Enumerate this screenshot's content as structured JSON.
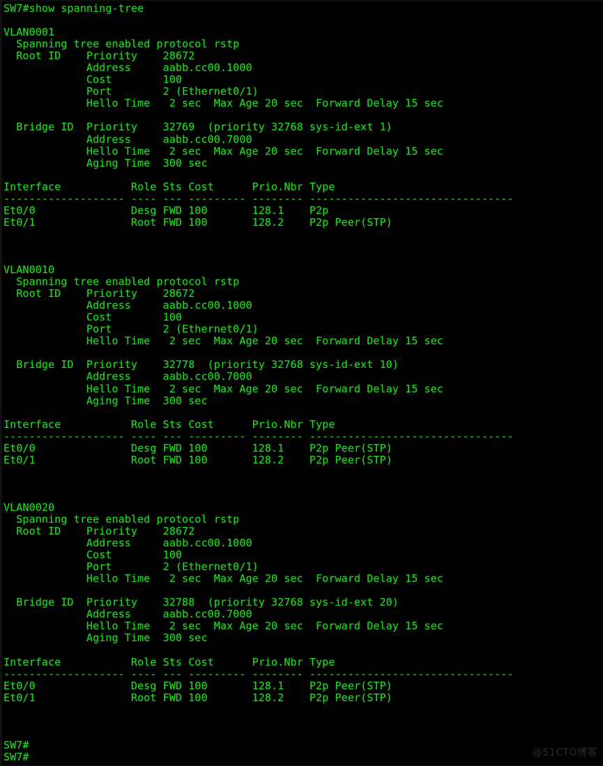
{
  "terminal": {
    "colors": {
      "background": "#000000",
      "foreground": "#1fd81f",
      "watermark": "#2c2c2c"
    },
    "prompt": "SW7#",
    "command": "show spanning-tree",
    "command_line": "SW7#show spanning-tree",
    "watermark": "@51CTO博客",
    "lines": [
      "SW7#show spanning-tree",
      "",
      "VLAN0001",
      "  Spanning tree enabled protocol rstp",
      "  Root ID    Priority    28672",
      "             Address     aabb.cc00.1000",
      "             Cost        100",
      "             Port        2 (Ethernet0/1)",
      "             Hello Time   2 sec  Max Age 20 sec  Forward Delay 15 sec",
      "",
      "  Bridge ID  Priority    32769  (priority 32768 sys-id-ext 1)",
      "             Address     aabb.cc00.7000",
      "             Hello Time   2 sec  Max Age 20 sec  Forward Delay 15 sec",
      "             Aging Time  300 sec",
      "",
      "Interface           Role Sts Cost      Prio.Nbr Type",
      "------------------- ---- --- --------- -------- --------------------------------",
      "Et0/0               Desg FWD 100       128.1    P2p",
      "Et0/1               Root FWD 100       128.2    P2p Peer(STP)",
      "",
      "",
      "",
      "VLAN0010",
      "  Spanning tree enabled protocol rstp",
      "  Root ID    Priority    28672",
      "             Address     aabb.cc00.1000",
      "             Cost        100",
      "             Port        2 (Ethernet0/1)",
      "             Hello Time   2 sec  Max Age 20 sec  Forward Delay 15 sec",
      "",
      "  Bridge ID  Priority    32778  (priority 32768 sys-id-ext 10)",
      "             Address     aabb.cc00.7000",
      "             Hello Time   2 sec  Max Age 20 sec  Forward Delay 15 sec",
      "             Aging Time  300 sec",
      "",
      "Interface           Role Sts Cost      Prio.Nbr Type",
      "------------------- ---- --- --------- -------- --------------------------------",
      "Et0/0               Desg FWD 100       128.1    P2p Peer(STP)",
      "Et0/1               Root FWD 100       128.2    P2p Peer(STP)",
      "",
      "",
      "",
      "VLAN0020",
      "  Spanning tree enabled protocol rstp",
      "  Root ID    Priority    28672",
      "             Address     aabb.cc00.1000",
      "             Cost        100",
      "             Port        2 (Ethernet0/1)",
      "             Hello Time   2 sec  Max Age 20 sec  Forward Delay 15 sec",
      "",
      "  Bridge ID  Priority    32788  (priority 32768 sys-id-ext 20)",
      "             Address     aabb.cc00.7000",
      "             Hello Time   2 sec  Max Age 20 sec  Forward Delay 15 sec",
      "             Aging Time  300 sec",
      "",
      "Interface           Role Sts Cost      Prio.Nbr Type",
      "------------------- ---- --- --------- -------- --------------------------------",
      "Et0/0               Desg FWD 100       128.1    P2p Peer(STP)",
      "Et0/1               Root FWD 100       128.2    P2p Peer(STP)",
      "",
      "",
      "",
      "SW7#",
      "SW7#"
    ]
  },
  "spanning_tree": {
    "table_headers": [
      "Interface",
      "Role",
      "Sts",
      "Cost",
      "Prio.Nbr",
      "Type"
    ],
    "vlans": [
      {
        "name": "VLAN0001",
        "protocol_line": "Spanning tree enabled protocol rstp",
        "protocol": "rstp",
        "root_id": {
          "priority": "28672",
          "address": "aabb.cc00.1000",
          "cost": "100",
          "port": "2 (Ethernet0/1)",
          "hello_time": "2 sec",
          "max_age": "20 sec",
          "forward_delay": "15 sec"
        },
        "bridge_id": {
          "priority": "32769",
          "priority_detail": "(priority 32768 sys-id-ext 1)",
          "base_priority": "32768",
          "sys_id_ext": "1",
          "address": "aabb.cc00.7000",
          "hello_time": "2 sec",
          "max_age": "20 sec",
          "forward_delay": "15 sec",
          "aging_time": "300 sec"
        },
        "interfaces": [
          {
            "interface": "Et0/0",
            "role": "Desg",
            "sts": "FWD",
            "cost": "100",
            "prio_nbr": "128.1",
            "type": "P2p"
          },
          {
            "interface": "Et0/1",
            "role": "Root",
            "sts": "FWD",
            "cost": "100",
            "prio_nbr": "128.2",
            "type": "P2p Peer(STP)"
          }
        ]
      },
      {
        "name": "VLAN0010",
        "protocol_line": "Spanning tree enabled protocol rstp",
        "protocol": "rstp",
        "root_id": {
          "priority": "28672",
          "address": "aabb.cc00.1000",
          "cost": "100",
          "port": "2 (Ethernet0/1)",
          "hello_time": "2 sec",
          "max_age": "20 sec",
          "forward_delay": "15 sec"
        },
        "bridge_id": {
          "priority": "32778",
          "priority_detail": "(priority 32768 sys-id-ext 10)",
          "base_priority": "32768",
          "sys_id_ext": "10",
          "address": "aabb.cc00.7000",
          "hello_time": "2 sec",
          "max_age": "20 sec",
          "forward_delay": "15 sec",
          "aging_time": "300 sec"
        },
        "interfaces": [
          {
            "interface": "Et0/0",
            "role": "Desg",
            "sts": "FWD",
            "cost": "100",
            "prio_nbr": "128.1",
            "type": "P2p Peer(STP)"
          },
          {
            "interface": "Et0/1",
            "role": "Root",
            "sts": "FWD",
            "cost": "100",
            "prio_nbr": "128.2",
            "type": "P2p Peer(STP)"
          }
        ]
      },
      {
        "name": "VLAN0020",
        "protocol_line": "Spanning tree enabled protocol rstp",
        "protocol": "rstp",
        "root_id": {
          "priority": "28672",
          "address": "aabb.cc00.1000",
          "cost": "100",
          "port": "2 (Ethernet0/1)",
          "hello_time": "2 sec",
          "max_age": "20 sec",
          "forward_delay": "15 sec"
        },
        "bridge_id": {
          "priority": "32788",
          "priority_detail": "(priority 32768 sys-id-ext 20)",
          "base_priority": "32768",
          "sys_id_ext": "20",
          "address": "aabb.cc00.7000",
          "hello_time": "2 sec",
          "max_age": "20 sec",
          "forward_delay": "15 sec",
          "aging_time": "300 sec"
        },
        "interfaces": [
          {
            "interface": "Et0/0",
            "role": "Desg",
            "sts": "FWD",
            "cost": "100",
            "prio_nbr": "128.1",
            "type": "P2p Peer(STP)"
          },
          {
            "interface": "Et0/1",
            "role": "Root",
            "sts": "FWD",
            "cost": "100",
            "prio_nbr": "128.2",
            "type": "P2p Peer(STP)"
          }
        ]
      }
    ]
  }
}
